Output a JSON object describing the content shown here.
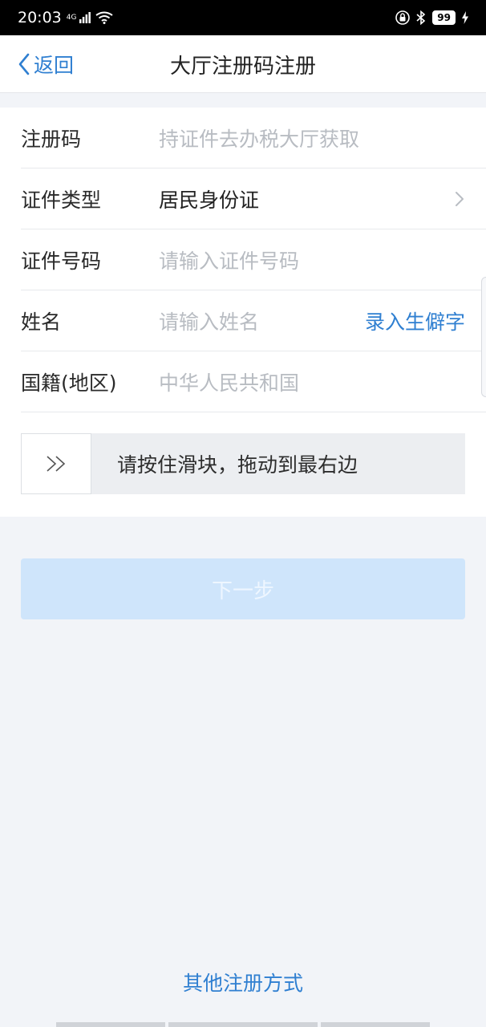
{
  "status_bar": {
    "time": "20:03",
    "network": "4G",
    "battery": "99",
    "icons": [
      "signal-icon",
      "wifi-icon",
      "lock-icon",
      "bluetooth-icon",
      "battery-icon",
      "charging-icon"
    ]
  },
  "nav": {
    "back_label": "返回",
    "title": "大厅注册码注册"
  },
  "form": {
    "rows": [
      {
        "label": "注册码",
        "placeholder": "持证件去办税大厅获取"
      },
      {
        "label": "证件类型",
        "value": "居民身份证"
      },
      {
        "label": "证件号码",
        "placeholder": "请输入证件号码"
      },
      {
        "label": "姓名",
        "placeholder": "请输入姓名",
        "action": "录入生僻字"
      },
      {
        "label": "国籍(地区)",
        "value": "中华人民共和国"
      }
    ]
  },
  "slider": {
    "text": "请按住滑块，拖动到最右边",
    "progress": 0
  },
  "next_button": {
    "label": "下一步",
    "enabled": false
  },
  "other_registration": "其他注册方式",
  "colors": {
    "accent": "#2f7fd1",
    "button_disabled": "#cfe5fb",
    "background": "#f2f4f8"
  }
}
